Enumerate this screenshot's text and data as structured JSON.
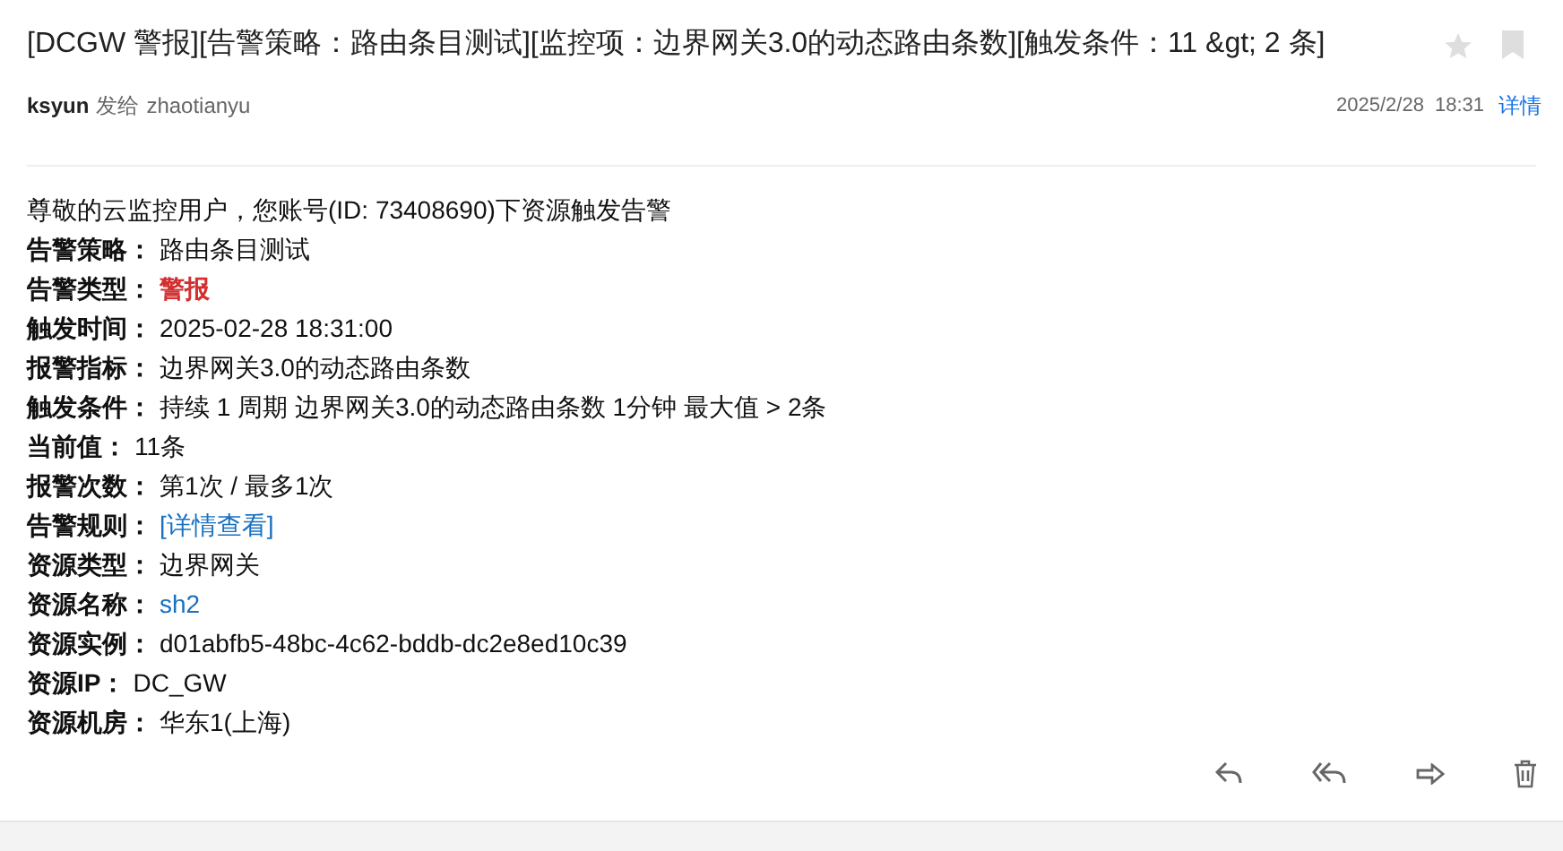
{
  "subject": "[DCGW 警报][告警策略：路由条目测试][监控项：边界网关3.0的动态路由条数][触发条件：11 &gt; 2 条]",
  "sender": {
    "from": "ksyun",
    "verb": "发给",
    "to": "zhaotianyu",
    "date": "2025/2/28",
    "time": "18:31",
    "details_link": "详情"
  },
  "greeting": "尊敬的云监控用户，您账号(ID: 73408690)下资源触发告警",
  "fields": [
    {
      "label": "告警策略：",
      "value": "路由条目测试",
      "kind": "text"
    },
    {
      "label": "告警类型：",
      "value": "警报",
      "kind": "alert"
    },
    {
      "label": "触发时间：",
      "value": "2025-02-28 18:31:00",
      "kind": "text"
    },
    {
      "label": "报警指标：",
      "value": "边界网关3.0的动态路由条数",
      "kind": "text"
    },
    {
      "label": "触发条件：",
      "value": "持续 1 周期 边界网关3.0的动态路由条数 1分钟 最大值 > 2条",
      "kind": "text"
    },
    {
      "label": "当前值：",
      "value": "11条",
      "kind": "text"
    },
    {
      "label": "报警次数：",
      "value": "第1次 / 最多1次",
      "kind": "text"
    },
    {
      "label": "告警规则：",
      "value": "[详情查看]",
      "kind": "link"
    },
    {
      "label": "资源类型：",
      "value": "边界网关",
      "kind": "text"
    },
    {
      "label": "资源名称：",
      "value": "sh2",
      "kind": "link"
    },
    {
      "label": "资源实例：",
      "value": "d01abfb5-48bc-4c62-bddb-dc2e8ed10c39",
      "kind": "text"
    },
    {
      "label": "资源IP：",
      "value": "DC_GW",
      "kind": "text"
    },
    {
      "label": "资源机房：",
      "value": "华东1(上海)",
      "kind": "text"
    }
  ]
}
